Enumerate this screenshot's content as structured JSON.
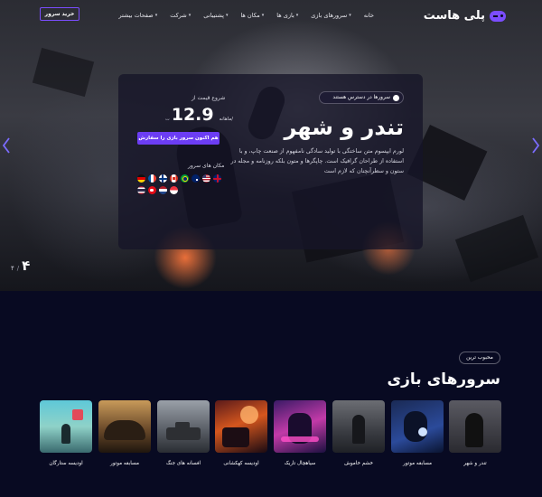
{
  "brand": {
    "name": "پلی هاست",
    "accent": "#6c3df4"
  },
  "nav": {
    "items": [
      {
        "label": "خانه",
        "dropdown": false
      },
      {
        "label": "سرورهای بازی",
        "dropdown": true
      },
      {
        "label": "بازی ها",
        "dropdown": true
      },
      {
        "label": "مکان ها",
        "dropdown": true
      },
      {
        "label": "پشتیبانی",
        "dropdown": true
      },
      {
        "label": "شرکت",
        "dropdown": true
      },
      {
        "label": "صفحات بیشتر",
        "dropdown": true
      }
    ],
    "buy_button": "خرید سرور"
  },
  "hero": {
    "availability": "سرورها در دسترس هستند",
    "title": "تندر و شهر",
    "description": "لورم ایپسوم متن ساختگی با تولید سادگی نامفهوم از صنعت چاپ، و با استفاده از طراحان گرافیک است. چاپگرها و متون بلکه روزنامه و مجله در ستون و سطرآنچنان که لازم است",
    "price_from": "شروع قیمت از",
    "currency": "ت",
    "price": "12.9",
    "per_month": "ماهانه/",
    "cta": "هم اکنون سرور بازی را سفارش",
    "locations_label": "مکان های سرور",
    "flags": [
      "de",
      "fr",
      "fi",
      "ca",
      "br",
      "au",
      "us",
      "uk",
      "th",
      "tr",
      "nl",
      "sg"
    ],
    "slide_current": "۴",
    "slide_total": "۴",
    "slide_sep": "/"
  },
  "games_section": {
    "badge": "محبوب ترین",
    "title": "سرورهای بازی",
    "games": [
      {
        "label": "تندر و شهر"
      },
      {
        "label": "مسابقه موتور"
      },
      {
        "label": "خشم خاموش"
      },
      {
        "label": "سیاهچال تاریک"
      },
      {
        "label": "اودیسه کهکشانی"
      },
      {
        "label": "افسانه های جنگ"
      },
      {
        "label": "مسابقه موتور"
      },
      {
        "label": "اودیسه ستارگان"
      }
    ]
  }
}
